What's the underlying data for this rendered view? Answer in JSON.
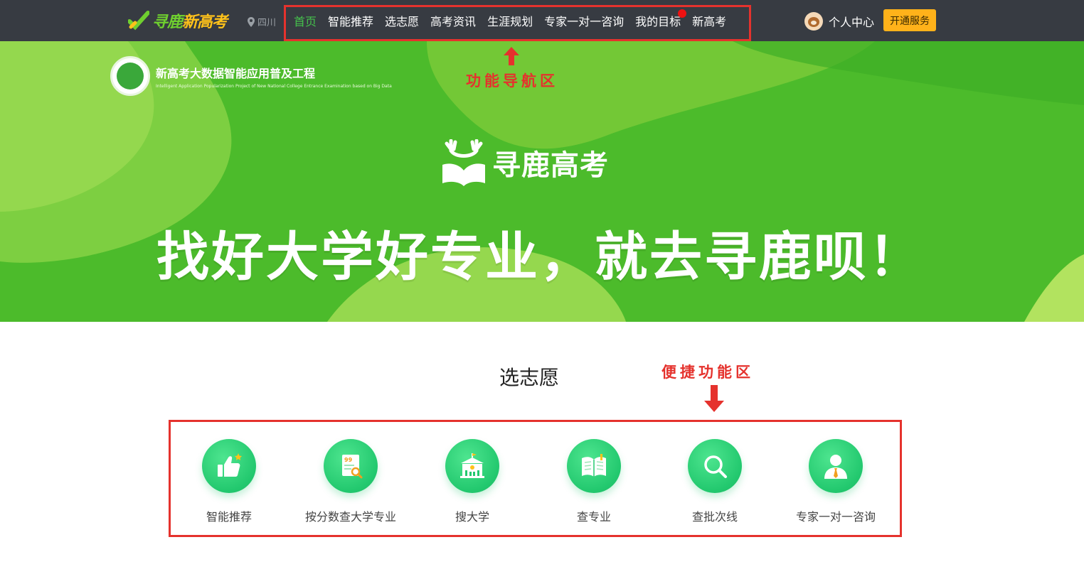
{
  "navbar": {
    "logo_part1": "寻鹿",
    "logo_part2": "新高考",
    "location": "四川",
    "items": [
      {
        "label": "首页",
        "active": true
      },
      {
        "label": "智能推荐"
      },
      {
        "label": "选志愿"
      },
      {
        "label": "高考资讯"
      },
      {
        "label": "生涯规划"
      },
      {
        "label": "专家一对一咨询"
      },
      {
        "label": "我的目标",
        "badge": "red-dot"
      },
      {
        "label": "新高考"
      }
    ],
    "user_center": "个人中心",
    "open_service": "开通服务"
  },
  "banner": {
    "project_cn": "新高考大数据智能应用普及工程",
    "project_en": "Intelligent Application Popularization Project of New National College Entrance Examination based on Big Data",
    "brand": "寻鹿高考",
    "slogan": "找好大学好专业，就去寻鹿呗！"
  },
  "annotations": {
    "nav_area": "功能导航区",
    "quick_area": "便捷功能区"
  },
  "quick_section": {
    "title": "选志愿",
    "items": [
      {
        "label": "智能推荐",
        "icon": "thumbs-up-icon"
      },
      {
        "label": "按分数查大学专业",
        "icon": "score-search-icon"
      },
      {
        "label": "搜大学",
        "icon": "university-icon"
      },
      {
        "label": "查专业",
        "icon": "book-icon"
      },
      {
        "label": "查批次线",
        "icon": "search-icon"
      },
      {
        "label": "专家一对一咨询",
        "icon": "expert-icon"
      }
    ]
  },
  "colors": {
    "navbar_bg": "#373b42",
    "active_nav": "#45c14c",
    "banner_green": "#4cbb2b",
    "accent_button": "#ffb21a",
    "annotation_red": "#e5322d",
    "icon_green": "#22c86e"
  }
}
